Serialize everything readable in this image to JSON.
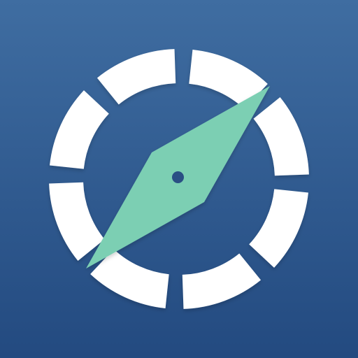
{
  "icon": {
    "name": "compass-icon",
    "colors": {
      "background_top": "#3f6da1",
      "background_bottom": "#234a80",
      "ring": "#ffffff",
      "needle": "#7ccfb3",
      "pivot": "#2a4f84"
    }
  }
}
